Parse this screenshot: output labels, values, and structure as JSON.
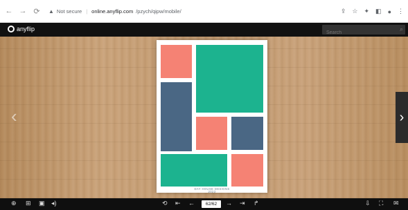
{
  "browser": {
    "security_label": "Not secure",
    "url_host": "online.anyflip.com",
    "url_path": "/pzych/qipw/mobile/"
  },
  "viewer": {
    "brand": "anyflip",
    "search_placeholder": "Search"
  },
  "page": {
    "caption_line1": "DAY HOUSE DESIGNS",
    "caption_line2": "2023",
    "colors": {
      "salmon": "#f58274",
      "teal": "#1cb38f",
      "slate": "#4a6784"
    }
  },
  "toolbar": {
    "page_indicator": "62/62"
  },
  "icons": {
    "back": "←",
    "forward": "→",
    "reload": "⟳",
    "share": "⇪",
    "star": "☆",
    "extension": "✦",
    "sidepanel": "◧",
    "profile": "●",
    "menu": "⋮",
    "zoom": "⊕",
    "thumbnails": "⊞",
    "text": "▣",
    "sound": "◂)",
    "first": "⇤",
    "prev": "←",
    "next": "→",
    "last": "⇥",
    "share_page": "↱",
    "download": "⇩",
    "fullscreen": "⛶",
    "mail": "✉",
    "left_page": "‹",
    "right_page": "›",
    "search": "⌕",
    "page_back": "⟲"
  }
}
